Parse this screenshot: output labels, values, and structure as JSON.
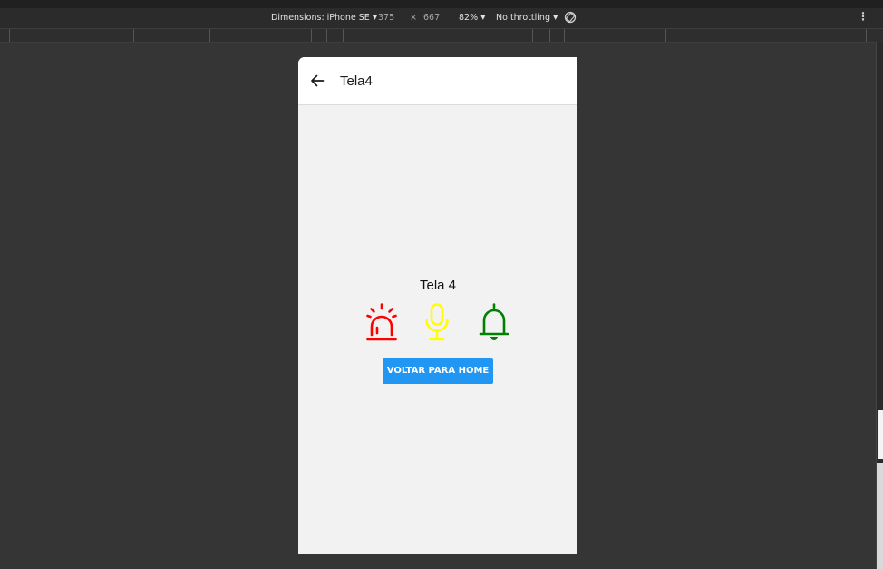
{
  "devtools": {
    "dimensions_label": "Dimensions: iPhone SE",
    "width": "375",
    "times": "×",
    "height": "667",
    "zoom": "82%",
    "throttling": "No throttling",
    "more_icon": "vertical-ellipsis-icon",
    "rotate_icon": "rotate-icon"
  },
  "app": {
    "title": "Tela4",
    "back_icon": "arrow-left-icon",
    "screen_text": "Tela 4",
    "icons": [
      {
        "name": "siren-icon",
        "color": "#ff0000"
      },
      {
        "name": "microphone-icon",
        "color": "#ffff00"
      },
      {
        "name": "bell-icon",
        "color": "#008000"
      }
    ],
    "home_button_label": "VOLTAR PARA HOME",
    "button_color": "#2196f3",
    "background_color": "#f2f2f2"
  }
}
